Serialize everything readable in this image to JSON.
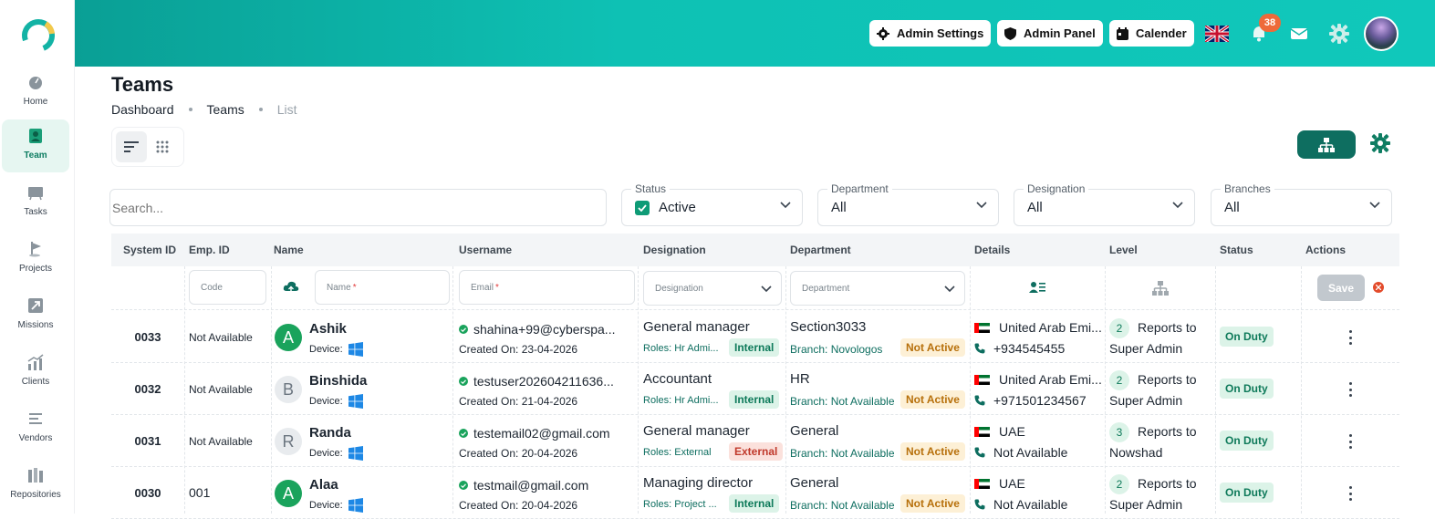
{
  "sidebar": {
    "items": [
      {
        "label": "Home",
        "icon": "home-icon"
      },
      {
        "label": "Team",
        "icon": "team-icon",
        "active": true
      },
      {
        "label": "Tasks",
        "icon": "tasks-icon"
      },
      {
        "label": "Projects",
        "icon": "projects-icon"
      },
      {
        "label": "Missions",
        "icon": "missions-icon"
      },
      {
        "label": "Clients",
        "icon": "clients-icon"
      },
      {
        "label": "Vendors",
        "icon": "vendors-icon"
      },
      {
        "label": "Repositories",
        "icon": "repositories-icon"
      }
    ]
  },
  "header": {
    "admin_settings": "Admin Settings",
    "admin_panel": "Admin Panel",
    "calender": "Calender",
    "notification_count": "38"
  },
  "page": {
    "title": "Teams",
    "breadcrumb": [
      "Dashboard",
      "Teams",
      "List"
    ]
  },
  "filters": {
    "search_placeholder": "Search...",
    "status": {
      "label": "Status",
      "value": "Active"
    },
    "department": {
      "label": "Department",
      "value": "All"
    },
    "designation": {
      "label": "Designation",
      "value": "All"
    },
    "branches": {
      "label": "Branches",
      "value": "All"
    }
  },
  "table": {
    "columns": [
      "System ID",
      "Emp. ID",
      "Name",
      "Username",
      "Designation",
      "Department",
      "Details",
      "Level",
      "Status",
      "Actions"
    ],
    "new_row": {
      "code_placeholder": "Code",
      "name_placeholder": "Name",
      "email_placeholder": "Email",
      "designation_placeholder": "Designation",
      "department_placeholder": "Department",
      "save": "Save"
    },
    "rows": [
      {
        "system_id": "0033",
        "emp_id": "Not Available",
        "initial": "A",
        "name": "Ashik",
        "device_label": "Device:",
        "email": "shahina+99@cyberspa...",
        "created": "Created On: 23-04-2026",
        "designation": "General manager",
        "roles": "Roles: Hr Admi...",
        "type": "Internal",
        "department": "Section3033",
        "branch": "Branch: Novologos",
        "branch_status": "Not Active",
        "country": "United Arab Emi...",
        "phone": "+934545455",
        "level": "2",
        "reports": "Reports to",
        "reports_to": "Super Admin",
        "status": "On Duty"
      },
      {
        "system_id": "0032",
        "emp_id": "Not Available",
        "initial": "B",
        "name": "Binshida",
        "device_label": "Device:",
        "email": "testuser202604211636...",
        "created": "Created On: 21-04-2026",
        "designation": "Accountant",
        "roles": "Roles: Hr Admi...",
        "type": "Internal",
        "department": "HR",
        "branch": "Branch: Not Available",
        "branch_status": "Not Active",
        "country": "United Arab Emi...",
        "phone": "+971501234567",
        "level": "2",
        "reports": "Reports to",
        "reports_to": "Super Admin",
        "status": "On Duty"
      },
      {
        "system_id": "0031",
        "emp_id": "Not Available",
        "initial": "R",
        "name": "Randa",
        "device_label": "Device:",
        "email": "testemail02@gmail.com",
        "created": "Created On: 20-04-2026",
        "designation": "General manager",
        "roles": "Roles: External",
        "type": "External",
        "department": "General",
        "branch": "Branch: Not Available",
        "branch_status": "Not Active",
        "country": "UAE",
        "phone": "Not Available",
        "level": "3",
        "reports": "Reports to",
        "reports_to": "Nowshad",
        "status": "On Duty"
      },
      {
        "system_id": "0030",
        "emp_id": "001",
        "initial": "A",
        "name": "Alaa",
        "device_label": "Device:",
        "email": "testmail@gmail.com",
        "created": "Created On: 20-04-2026",
        "designation": "Managing director",
        "roles": "Roles: Project ...",
        "type": "Internal",
        "department": "General",
        "branch": "Branch: Not Available",
        "branch_status": "Not Active",
        "country": "UAE",
        "phone": "Not Available",
        "level": "2",
        "reports": "Reports to",
        "reports_to": "Super Admin",
        "status": "On Duty"
      }
    ]
  },
  "colors": {
    "brand": "#0e6e60",
    "accent": "#10c8bb",
    "badge": "#ee6a3a"
  }
}
